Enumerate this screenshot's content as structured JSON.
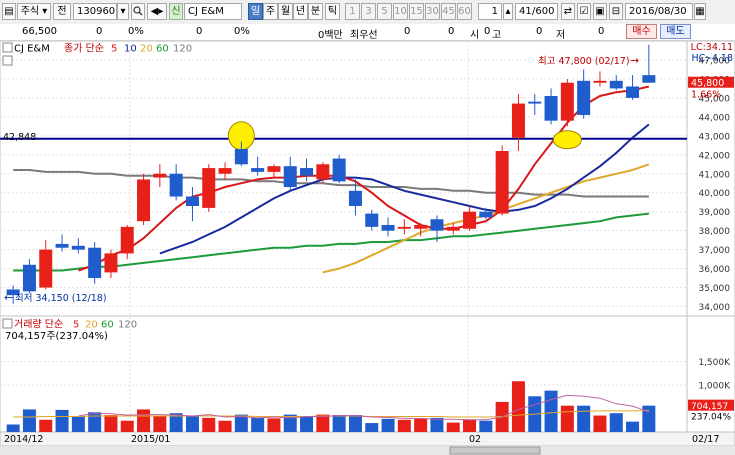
{
  "toolbar": {
    "menu_label": "주식",
    "prev_label": "전",
    "code": "130960",
    "sector_tag": "신",
    "stock_name": "CJ E&M",
    "periods": [
      "일",
      "주",
      "월",
      "년",
      "분",
      "틱"
    ],
    "selected_period": "일",
    "intervals": [
      "1",
      "3",
      "5",
      "10",
      "15",
      "30",
      "45",
      "60"
    ],
    "count_value": "1",
    "page_current": "41",
    "page_total": "/600",
    "date": "2016/08/30"
  },
  "infobar": {
    "price": "66,500",
    "change": "0",
    "change_rate": "0%",
    "volume": "0",
    "volume_rate": "0%",
    "amount": "0백만",
    "best_ask_label": "최우선",
    "best_ask_1": "0",
    "best_ask_2": "0",
    "open_label": "시",
    "open_value": "0",
    "high_label": "고",
    "high_value": "0",
    "low_label": "저",
    "low_value": "0",
    "buy_label": "매수",
    "sell_label": "매도"
  },
  "price_panel": {
    "title_name": "CJ E&M",
    "title_legend": "종가 단순",
    "ma_periods": [
      "5",
      "10",
      "20",
      "60",
      "120"
    ],
    "lc_label": "LC:34.11",
    "hc_label": "HC:-4.18",
    "high_annotation": "최고 47,800 (02/17)",
    "low_annotation": "최저 34,150 (12/18)",
    "hline_label": "42,848",
    "last_price_tag": "45,800",
    "last_change_tag": "1.66%"
  },
  "volume_panel": {
    "title": "거래량 단순",
    "ma_periods": [
      "5",
      "20",
      "60",
      "120"
    ],
    "volume_label": "704,157주(237.04%)",
    "last_volume_tag": "704,157",
    "last_ratio_tag": "237.04%"
  },
  "x_axis": {
    "labels": [
      "2014/12",
      "2015/01",
      "02"
    ],
    "end_label": "02/17"
  },
  "colors": {
    "up": "#e8201a",
    "down": "#1f5ccc",
    "ma5": "#d81818",
    "ma10": "#1a2a9c",
    "ma20": "#e0a82a",
    "ma60": "#1e9a38",
    "ma120": "#7a7a7a",
    "hline": "#000090",
    "marker": "#ffee00"
  },
  "chart_data": {
    "type": "candlestick",
    "price_ylim": [
      33500,
      48000
    ],
    "price_ticks": [
      34000,
      35000,
      36000,
      37000,
      38000,
      39000,
      40000,
      41000,
      42000,
      43000,
      44000,
      45000,
      46000,
      47000
    ],
    "volume_ylim": [
      0,
      2000
    ],
    "volume_ticks": [
      1000,
      1500
    ],
    "volume_tick_labels": [
      "1,000K",
      "1,500K"
    ],
    "hline": 42848,
    "candles": [
      {
        "o": 34900,
        "h": 35100,
        "l": 34150,
        "c": 34600
      },
      {
        "o": 36200,
        "h": 36500,
        "l": 34700,
        "c": 34800
      },
      {
        "o": 35000,
        "h": 37500,
        "l": 34900,
        "c": 37000
      },
      {
        "o": 37300,
        "h": 37800,
        "l": 36900,
        "c": 37100
      },
      {
        "o": 37200,
        "h": 37600,
        "l": 36800,
        "c": 37000
      },
      {
        "o": 37100,
        "h": 37400,
        "l": 35200,
        "c": 35500
      },
      {
        "o": 35800,
        "h": 37000,
        "l": 35500,
        "c": 36800
      },
      {
        "o": 36800,
        "h": 38300,
        "l": 36500,
        "c": 38200
      },
      {
        "o": 38500,
        "h": 41000,
        "l": 38300,
        "c": 40700
      },
      {
        "o": 40800,
        "h": 41500,
        "l": 40300,
        "c": 41000
      },
      {
        "o": 41000,
        "h": 41500,
        "l": 39600,
        "c": 39800
      },
      {
        "o": 39800,
        "h": 40300,
        "l": 38500,
        "c": 39300
      },
      {
        "o": 39200,
        "h": 41500,
        "l": 39000,
        "c": 41300
      },
      {
        "o": 41000,
        "h": 41600,
        "l": 40700,
        "c": 41300
      },
      {
        "o": 42300,
        "h": 42700,
        "l": 41400,
        "c": 41500
      },
      {
        "o": 41300,
        "h": 41900,
        "l": 40900,
        "c": 41100
      },
      {
        "o": 41100,
        "h": 41500,
        "l": 40800,
        "c": 41400
      },
      {
        "o": 41400,
        "h": 41900,
        "l": 40100,
        "c": 40300
      },
      {
        "o": 41300,
        "h": 41800,
        "l": 40600,
        "c": 40900
      },
      {
        "o": 40700,
        "h": 41600,
        "l": 40500,
        "c": 41500
      },
      {
        "o": 41800,
        "h": 42000,
        "l": 40500,
        "c": 40600
      },
      {
        "o": 40100,
        "h": 40700,
        "l": 38800,
        "c": 39300
      },
      {
        "o": 38900,
        "h": 39100,
        "l": 38000,
        "c": 38200
      },
      {
        "o": 38300,
        "h": 38700,
        "l": 37700,
        "c": 38000
      },
      {
        "o": 38100,
        "h": 38600,
        "l": 37800,
        "c": 38200
      },
      {
        "o": 38100,
        "h": 38400,
        "l": 37700,
        "c": 38300
      },
      {
        "o": 38600,
        "h": 38800,
        "l": 37400,
        "c": 38000
      },
      {
        "o": 38000,
        "h": 38400,
        "l": 37800,
        "c": 38200
      },
      {
        "o": 38100,
        "h": 39300,
        "l": 38000,
        "c": 39000
      },
      {
        "o": 39000,
        "h": 39200,
        "l": 38600,
        "c": 38700
      },
      {
        "o": 38900,
        "h": 42500,
        "l": 38800,
        "c": 42200
      },
      {
        "o": 42900,
        "h": 45200,
        "l": 42200,
        "c": 44700
      },
      {
        "o": 44800,
        "h": 45200,
        "l": 44100,
        "c": 44700
      },
      {
        "o": 45100,
        "h": 45500,
        "l": 43600,
        "c": 43800
      },
      {
        "o": 43800,
        "h": 46000,
        "l": 43500,
        "c": 45800
      },
      {
        "o": 45900,
        "h": 46500,
        "l": 43900,
        "c": 44100
      },
      {
        "o": 45800,
        "h": 46400,
        "l": 45600,
        "c": 45900
      },
      {
        "o": 45900,
        "h": 46200,
        "l": 45400,
        "c": 45500
      },
      {
        "o": 45600,
        "h": 46200,
        "l": 44900,
        "c": 45000
      },
      {
        "o": 46200,
        "h": 47800,
        "l": 45800,
        "c": 45800
      }
    ],
    "volumes": [
      160,
      480,
      260,
      470,
      340,
      420,
      360,
      240,
      480,
      340,
      400,
      330,
      300,
      240,
      370,
      300,
      290,
      370,
      330,
      370,
      360,
      360,
      190,
      280,
      260,
      280,
      300,
      200,
      260,
      240,
      640,
      1080,
      760,
      880,
      560,
      560,
      350,
      400,
      220,
      560
    ],
    "ma5": [
      null,
      null,
      null,
      null,
      35900,
      36200,
      36700,
      37000,
      37600,
      38400,
      39200,
      39800,
      40000,
      40300,
      40500,
      40700,
      40800,
      40800,
      40900,
      40900,
      40900,
      40600,
      40000,
      39300,
      38800,
      38300,
      38100,
      38100,
      38300,
      38500,
      39100,
      40200,
      41500,
      42600,
      43700,
      44600,
      45100,
      45300,
      45400,
      45600
    ],
    "ma10": [
      null,
      null,
      null,
      null,
      null,
      null,
      null,
      null,
      null,
      36800,
      37100,
      37400,
      37800,
      38200,
      38700,
      39200,
      39700,
      40100,
      40400,
      40700,
      40800,
      40800,
      40700,
      40400,
      40100,
      39900,
      39700,
      39500,
      39300,
      39100,
      39000,
      39100,
      39300,
      39700,
      40200,
      40800,
      41400,
      42100,
      42900,
      43600
    ],
    "ma20": [
      null,
      null,
      null,
      null,
      null,
      null,
      null,
      null,
      null,
      null,
      null,
      null,
      null,
      null,
      null,
      null,
      null,
      null,
      null,
      35800,
      36000,
      36300,
      36700,
      37100,
      37500,
      37900,
      38200,
      38400,
      38600,
      38800,
      39100,
      39400,
      39700,
      40000,
      40300,
      40600,
      40800,
      41000,
      41200,
      41500
    ],
    "ma60": [
      35900,
      35900,
      35900,
      35900,
      36000,
      36100,
      36100,
      36200,
      36300,
      36400,
      36500,
      36600,
      36700,
      36800,
      36900,
      37000,
      37100,
      37100,
      37200,
      37200,
      37300,
      37300,
      37400,
      37400,
      37500,
      37500,
      37600,
      37700,
      37700,
      37800,
      37900,
      38000,
      38100,
      38200,
      38300,
      38400,
      38500,
      38700,
      38800,
      38900
    ],
    "ma120": [
      41200,
      41200,
      41100,
      41100,
      41100,
      41000,
      41000,
      40900,
      40900,
      40900,
      40800,
      40800,
      40700,
      40700,
      40700,
      40600,
      40600,
      40500,
      40500,
      40500,
      40400,
      40400,
      40300,
      40300,
      40300,
      40200,
      40200,
      40100,
      40100,
      40000,
      40000,
      40000,
      39900,
      39900,
      39900,
      39800,
      39800,
      39800,
      39800,
      39800
    ],
    "vol_ma5": [
      null,
      null,
      null,
      null,
      340,
      400,
      390,
      360,
      370,
      370,
      360,
      340,
      370,
      320,
      330,
      300,
      320,
      300,
      330,
      330,
      350,
      350,
      320,
      310,
      290,
      290,
      270,
      270,
      260,
      260,
      320,
      480,
      580,
      690,
      780,
      760,
      720,
      600,
      550,
      430
    ],
    "vol_ma20": [
      320,
      320,
      330,
      330,
      330,
      340,
      340,
      340,
      340,
      340,
      340,
      340,
      340,
      340,
      340,
      330,
      330,
      330,
      330,
      340,
      340,
      340,
      330,
      330,
      330,
      330,
      330,
      320,
      320,
      320,
      330,
      360,
      380,
      410,
      430,
      440,
      450,
      450,
      450,
      460
    ]
  }
}
